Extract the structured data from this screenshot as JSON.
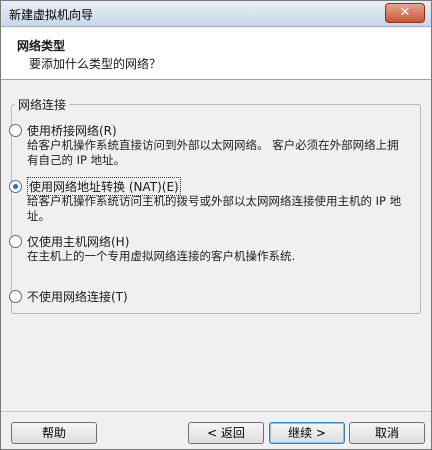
{
  "window": {
    "title": "新建虚拟机向导",
    "close_label": "✕"
  },
  "header": {
    "title": "网络类型",
    "subtitle": "要添加什么类型的网络？"
  },
  "group": {
    "legend": "网络连接",
    "options": [
      {
        "label": "使用桥接网络(R)",
        "desc": "给客户机操作系统直接访问到外部以太网网络。 客户必须在外部网络上拥有自己的 IP 地址。",
        "checked": false
      },
      {
        "label": "使用网络地址转换 (NAT)(E)",
        "desc": "给客户机操作系统访问主机的拨号或外部以太网网络连接使用主机的 IP 地址。",
        "checked": true
      },
      {
        "label": "仅使用主机网络(H)",
        "desc": "在主机上的一个专用虚拟网络连接的客户机操作系统.",
        "checked": false
      },
      {
        "label": "不使用网络连接(T)",
        "desc": "",
        "checked": false
      }
    ]
  },
  "footer": {
    "help": "帮助",
    "back": "< 返回",
    "next": "继续 >",
    "cancel": "取消"
  }
}
